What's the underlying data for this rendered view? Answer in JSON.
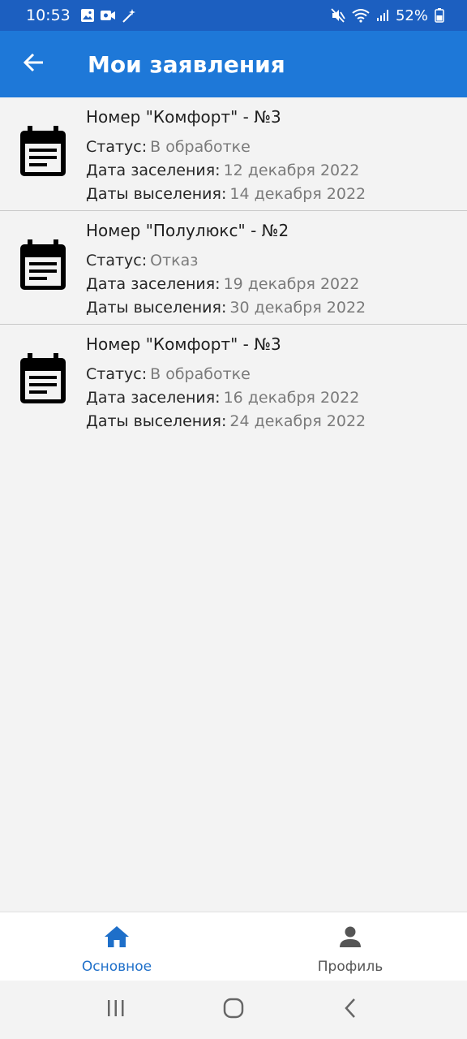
{
  "status_bar": {
    "time": "10:53",
    "battery": "52%",
    "left_icons": [
      "image-icon",
      "video-icon",
      "magic-wand-icon"
    ],
    "right_icons": [
      "mute-icon",
      "wifi-icon",
      "signal-icon",
      "battery-icon"
    ]
  },
  "app_bar": {
    "title": "Мои заявления",
    "back_icon": "arrow-left-icon",
    "background": "#1e78d8"
  },
  "applications": [
    {
      "title": "Номер \"Комфорт\" - №3",
      "status_label": "Статус:",
      "status_value": "В обработке",
      "checkin_label": "Дата заселения:",
      "checkin_value": "12 декабря 2022",
      "checkout_label": "Даты выселения:",
      "checkout_value": "14 декабря 2022",
      "icon": "calendar-icon"
    },
    {
      "title": "Номер \"Полулюкс\" - №2",
      "status_label": "Статус:",
      "status_value": "Отказ",
      "checkin_label": "Дата заселения:",
      "checkin_value": "19 декабря 2022",
      "checkout_label": "Даты выселения:",
      "checkout_value": "30 декабря 2022",
      "icon": "calendar-icon"
    },
    {
      "title": "Номер \"Комфорт\" - №3",
      "status_label": "Статус:",
      "status_value": "В обработке",
      "checkin_label": "Дата заселения:",
      "checkin_value": "16 декабря 2022",
      "checkout_label": "Даты выселения:",
      "checkout_value": "24 декабря 2022",
      "icon": "calendar-icon"
    }
  ],
  "bottom_nav": {
    "items": [
      {
        "label": "Основное",
        "icon": "home-icon",
        "active": true
      },
      {
        "label": "Профиль",
        "icon": "person-icon",
        "active": false
      }
    ],
    "active_color": "#1e6fc9"
  },
  "system_nav": {
    "buttons": [
      "recents-icon",
      "home-circle-icon",
      "back-chevron-icon"
    ]
  }
}
